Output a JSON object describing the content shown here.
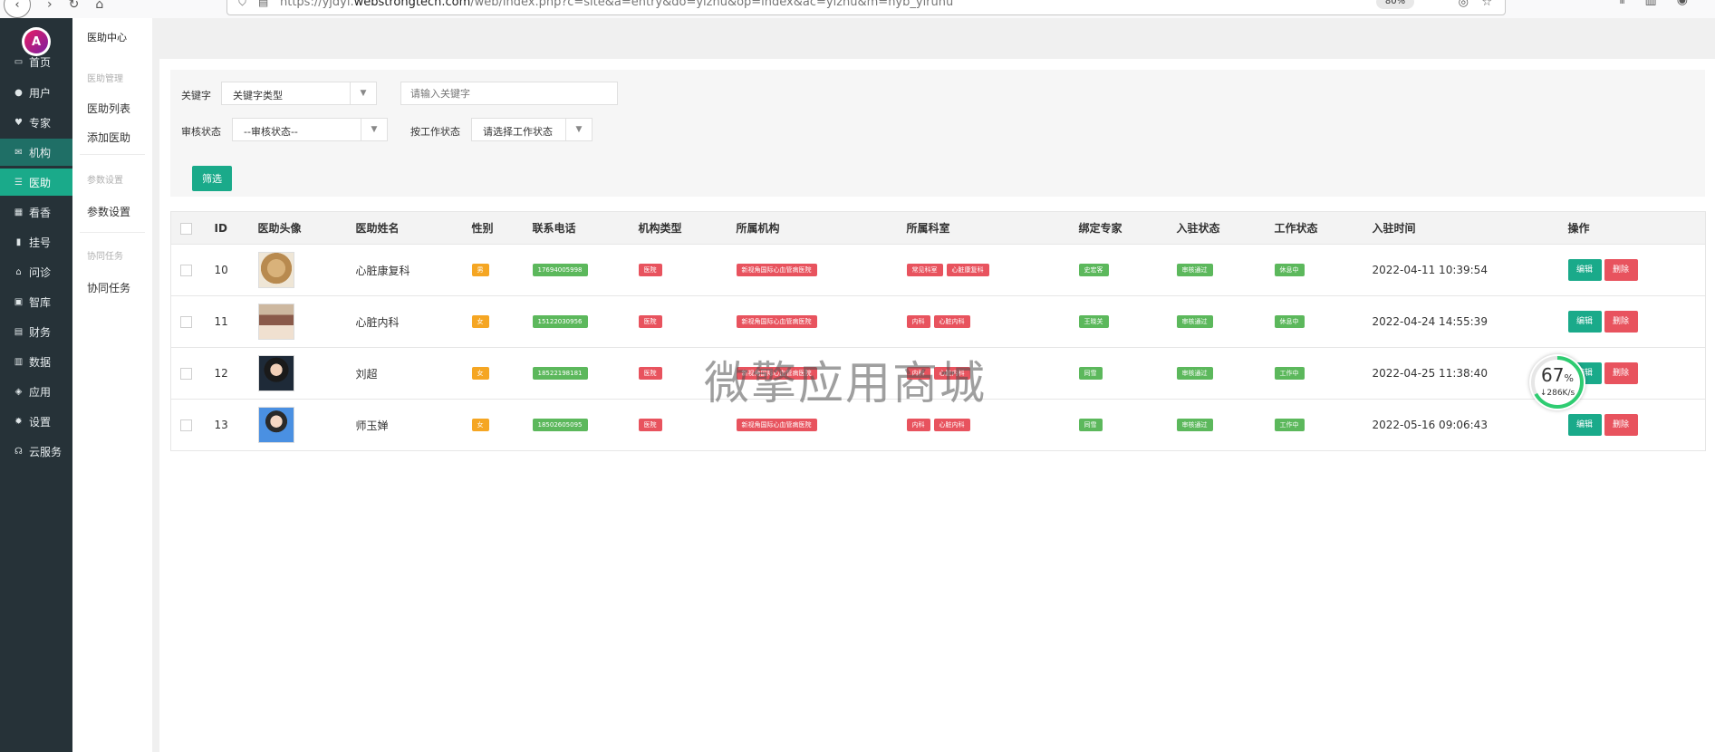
{
  "browser": {
    "url_prefix": "https://yjdyi.",
    "url_domain": "webstrongtech.com",
    "url_rest": "/web/index.php?c=site&a=entry&do=yizhu&op=index&ac=yizhu&m=nyb_yiruhu",
    "zoom": "80%"
  },
  "sidebar": {
    "items": [
      {
        "label": "首页",
        "icon": "monitor-icon",
        "glyph": "▭"
      },
      {
        "label": "用户",
        "icon": "user-icon",
        "glyph": "●"
      },
      {
        "label": "专家",
        "icon": "heart-icon",
        "glyph": "♥"
      },
      {
        "label": "机构",
        "icon": "envelope-icon",
        "glyph": "✉"
      },
      {
        "label": "医助",
        "icon": "list-icon",
        "glyph": "☰"
      },
      {
        "label": "看香",
        "icon": "table-icon",
        "glyph": "▦"
      },
      {
        "label": "挂号",
        "icon": "bar-chart-icon",
        "glyph": "▮"
      },
      {
        "label": "问诊",
        "icon": "home-icon",
        "glyph": "⌂"
      },
      {
        "label": "智库",
        "icon": "lock-icon",
        "glyph": "▣"
      },
      {
        "label": "财务",
        "icon": "money-icon",
        "glyph": "▤"
      },
      {
        "label": "数据",
        "icon": "data-icon",
        "glyph": "▥"
      },
      {
        "label": "应用",
        "icon": "cubes-icon",
        "glyph": "◈"
      },
      {
        "label": "设置",
        "icon": "gear-icon",
        "glyph": "✹"
      },
      {
        "label": "云服务",
        "icon": "headset-icon",
        "glyph": "☊"
      }
    ]
  },
  "sub_sidebar": {
    "title": "医助中心",
    "group1": "医助管理",
    "link_list": "医助列表",
    "link_add": "添加医助",
    "group2": "参数设置",
    "link_params": "参数设置",
    "group3": "协同任务",
    "link_tasks": "协同任务"
  },
  "filter": {
    "keyword_label": "关键字",
    "keyword_type": "关键字类型",
    "keyword_placeholder": "请输入关键字",
    "review_label": "审核状态",
    "review_value": "--审核状态--",
    "work_label": "按工作状态",
    "work_value": "请选择工作状态",
    "button": "筛选"
  },
  "table": {
    "headers": [
      "ID",
      "医助头像",
      "医助姓名",
      "性别",
      "联系电话",
      "机构类型",
      "所属机构",
      "所属科室",
      "绑定专家",
      "入驻状态",
      "工作状态",
      "入驻时间",
      "操作"
    ],
    "edit_label": "编辑",
    "delete_label": "删除",
    "rows": [
      {
        "id": "10",
        "name": "心脏康复科",
        "gender": "男",
        "phone": "17694005998",
        "org_type": "医院",
        "org": "新视角国际心血管病医院",
        "dept1": "常见科室",
        "dept2": "心脏康复科",
        "expert": "史宏客",
        "enter": "审核通过",
        "work": "休息中",
        "time": "2022-04-11 10:39:54"
      },
      {
        "id": "11",
        "name": "心脏内科",
        "gender": "女",
        "phone": "15122030956",
        "org_type": "医院",
        "org": "新视角国际心血管病医院",
        "dept1": "内科",
        "dept2": "心脏内科",
        "expert": "王晓关",
        "enter": "审核通过",
        "work": "休息中",
        "time": "2022-04-24 14:55:39"
      },
      {
        "id": "12",
        "name": "刘超",
        "gender": "女",
        "phone": "18522198181",
        "org_type": "医院",
        "org": "新视角国际心血管病医院",
        "dept1": "内科",
        "dept2": "心脏内科",
        "expert": "同雪",
        "enter": "审核通过",
        "work": "工作中",
        "time": "2022-04-25 11:38:40"
      },
      {
        "id": "13",
        "name": "师玉婵",
        "gender": "女",
        "phone": "18502605095",
        "org_type": "医院",
        "org": "新视角国际心血管病医院",
        "dept1": "内科",
        "dept2": "心脏内科",
        "expert": "同雪",
        "enter": "审核通过",
        "work": "工作中",
        "time": "2022-05-16 09:06:43"
      }
    ]
  },
  "watermark": "微擎应用商城",
  "speed_widget": {
    "percent": "67",
    "percent_unit": "%",
    "rate": "↓286K/s"
  },
  "colors": {
    "accent": "#1aaa8a",
    "sidebar_bg": "#263238",
    "danger": "#e8535e",
    "tag_orange": "#f5a623",
    "tag_green": "#5cb85c"
  }
}
